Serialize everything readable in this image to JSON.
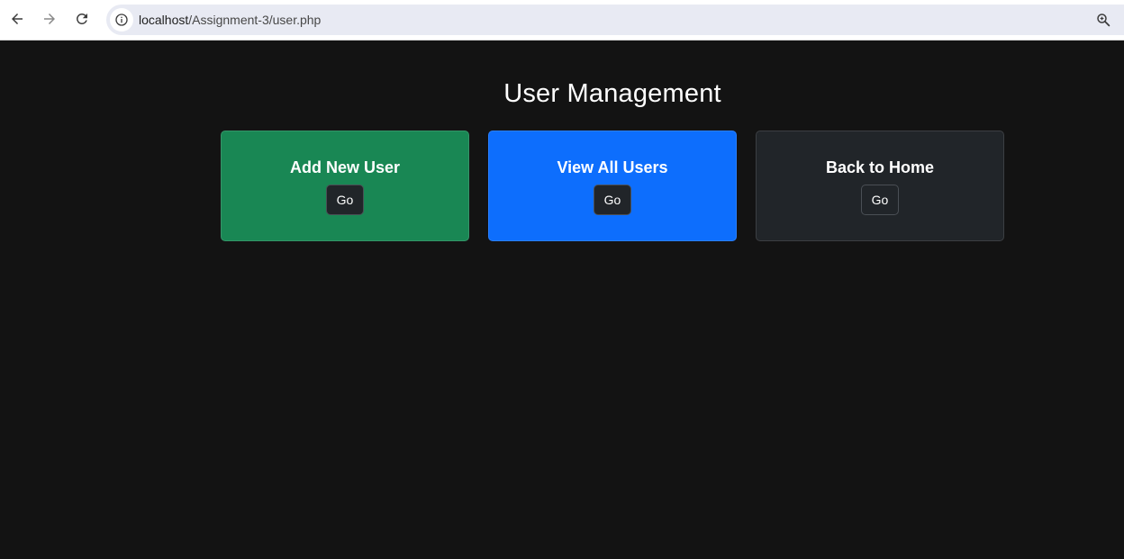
{
  "browser": {
    "url_host": "localhost",
    "url_path": "/Assignment-3/user.php"
  },
  "page": {
    "title": "User Management"
  },
  "cards": [
    {
      "title": "Add New User",
      "button_label": "Go",
      "color": "#198754"
    },
    {
      "title": "View All Users",
      "button_label": "Go",
      "color": "#0d6efd"
    },
    {
      "title": "Back to Home",
      "button_label": "Go",
      "color": "#212529"
    }
  ],
  "icons": {
    "back": "arrow-left-icon",
    "forward": "arrow-right-icon",
    "reload": "reload-icon",
    "site_info": "info-icon",
    "zoom": "zoom-icon"
  }
}
